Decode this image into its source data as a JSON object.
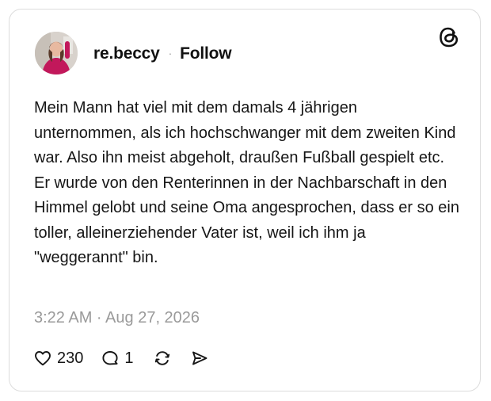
{
  "post": {
    "author": {
      "username": "re.beccy",
      "separator": "·",
      "follow_label": "Follow"
    },
    "brand_icon": "threads-logo-icon",
    "text": "Mein Mann hat viel mit dem damals 4 jährigen unternommen, als ich hochschwanger mit dem zweiten Kind war. Also ihn meist abgeholt, draußen Fußball gespielt etc. Er wurde von den Renterinnen in der Nachbarschaft in den Himmel gelobt und seine Oma angesprochen, dass er so ein toller, alleinerziehender Vater ist, weil ich ihm ja \"weggerannt\" bin.",
    "timestamp": "3:22 AM · Aug 27, 2026",
    "actions": {
      "like": {
        "icon": "heart-icon",
        "count": "230"
      },
      "reply": {
        "icon": "comment-icon",
        "count": "1"
      },
      "repost": {
        "icon": "repost-icon"
      },
      "share": {
        "icon": "send-icon"
      }
    }
  },
  "colors": {
    "text": "#161616",
    "muted": "#9a9a9a",
    "border": "#dcdcdc",
    "background": "#ffffff"
  }
}
